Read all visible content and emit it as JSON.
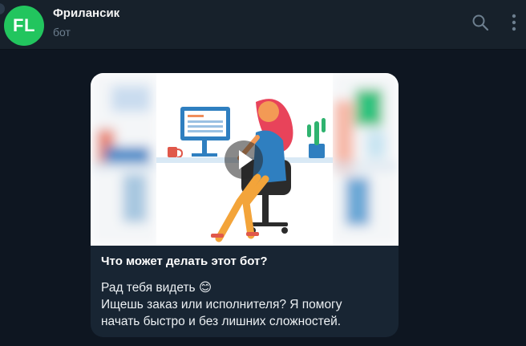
{
  "header": {
    "avatar_text": "FL",
    "title": "Фрилансик",
    "subtitle": "бот",
    "icons": [
      "search-icon",
      "more-vertical-icon"
    ]
  },
  "message": {
    "media_type": "video",
    "media_icon": "play-icon",
    "title": "Что может делать этот бот?",
    "lines": [
      "Рад тебя видеть 😊",
      "Ищешь заказ или исполнителя? Я помогу",
      "начать быстро и без лишних сложностей."
    ]
  },
  "colors": {
    "app_background": "#0e1621",
    "header_background": "#17212b",
    "bubble_background": "#182533",
    "avatar_green": "#22c55e",
    "subtitle_gray": "#6d7f8f"
  }
}
